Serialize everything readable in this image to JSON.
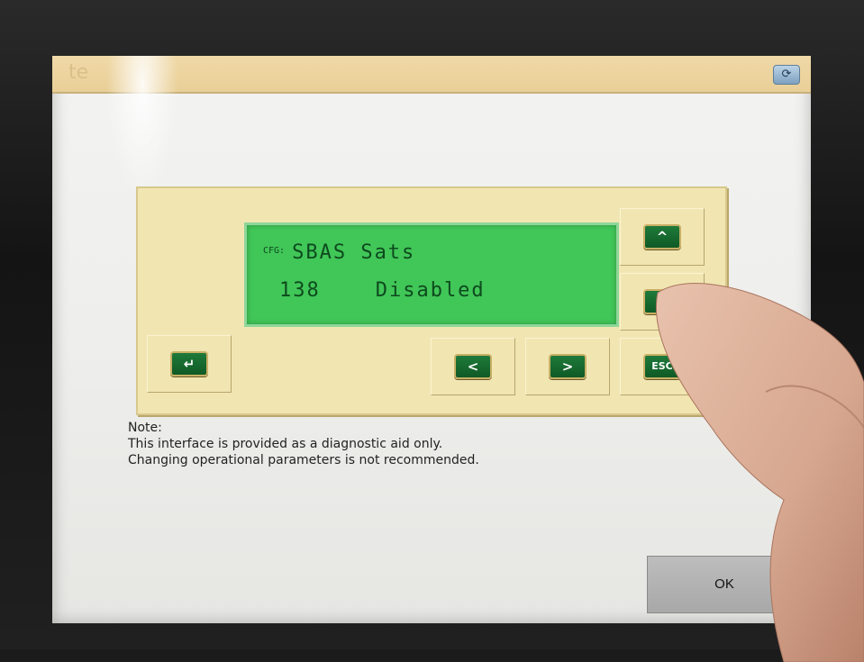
{
  "window": {
    "title": "te",
    "corner_icon": "refresh-icon"
  },
  "lcd": {
    "line1_tag": "CFG:",
    "line1_text": "SBAS Sats",
    "line2_text": "138    Disabled"
  },
  "keys": {
    "up": "^",
    "left": "<",
    "right": ">",
    "esc": "ESC",
    "enter": "↵",
    "middle": ""
  },
  "note": {
    "heading": "Note:",
    "line1": "This interface is provided as a diagnostic aid only.",
    "line2": "Changing operational parameters is not recommended."
  },
  "ok_button": "OK",
  "colors": {
    "panel": "#f1e6b2",
    "lcd": "#41c658",
    "key": "#0f5a25",
    "titlebar": "#e9cf97"
  }
}
